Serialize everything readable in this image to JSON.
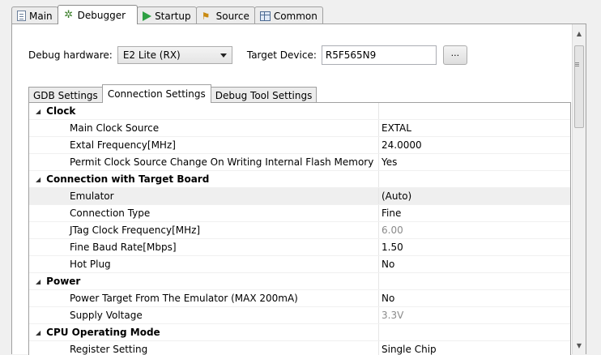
{
  "tabs": [
    {
      "label": "Main",
      "icon": "document-icon",
      "active": false
    },
    {
      "label": "Debugger",
      "icon": "debugger-icon",
      "active": true
    },
    {
      "label": "Startup",
      "icon": "play-icon",
      "active": false
    },
    {
      "label": "Source",
      "icon": "source-icon",
      "active": false
    },
    {
      "label": "Common",
      "icon": "common-icon",
      "active": false
    }
  ],
  "debug_hardware": {
    "label": "Debug hardware:",
    "value": "E2 Lite (RX)"
  },
  "target_device": {
    "label": "Target Device:",
    "value": "R5F565N9",
    "browse_label": "..."
  },
  "inner_tabs": [
    {
      "label": "GDB Settings",
      "active": false
    },
    {
      "label": "Connection Settings",
      "active": true
    },
    {
      "label": "Debug Tool Settings",
      "active": false
    }
  ],
  "properties": [
    {
      "type": "category",
      "label": "Clock"
    },
    {
      "type": "prop",
      "label": "Main Clock Source",
      "value": "EXTAL",
      "disabled": false
    },
    {
      "type": "prop",
      "label": "Extal Frequency[MHz]",
      "value": "24.0000",
      "disabled": false
    },
    {
      "type": "prop",
      "label": "Permit Clock Source Change On Writing Internal Flash Memory",
      "value": "Yes",
      "disabled": false
    },
    {
      "type": "category",
      "label": "Connection with Target Board"
    },
    {
      "type": "prop",
      "label": "Emulator",
      "value": "(Auto)",
      "disabled": false,
      "selected": true
    },
    {
      "type": "prop",
      "label": "Connection Type",
      "value": "Fine",
      "disabled": false
    },
    {
      "type": "prop",
      "label": "JTag Clock Frequency[MHz]",
      "value": "6.00",
      "disabled": true
    },
    {
      "type": "prop",
      "label": "Fine Baud Rate[Mbps]",
      "value": "1.50",
      "disabled": false
    },
    {
      "type": "prop",
      "label": "Hot Plug",
      "value": "No",
      "disabled": false
    },
    {
      "type": "category",
      "label": "Power"
    },
    {
      "type": "prop",
      "label": "Power Target From The Emulator (MAX 200mA)",
      "value": "No",
      "disabled": false
    },
    {
      "type": "prop",
      "label": "Supply Voltage",
      "value": "3.3V",
      "disabled": true
    },
    {
      "type": "category",
      "label": "CPU Operating Mode"
    },
    {
      "type": "prop",
      "label": "Register Setting",
      "value": "Single Chip",
      "disabled": false
    }
  ],
  "colors": {
    "panel_bg": "#ffffff",
    "window_bg": "#f0f0f0",
    "disabled_text": "#8a8a8a",
    "selected_row": "#efefef"
  }
}
